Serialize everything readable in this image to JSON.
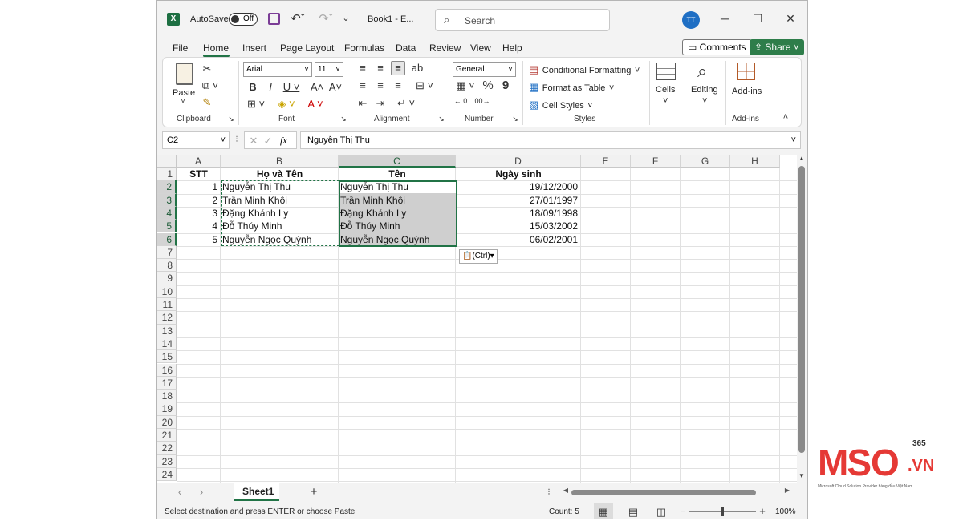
{
  "titlebar": {
    "app_icon": "excel-icon",
    "autosave_label": "AutoSave",
    "autosave_state": "Off",
    "doc_name": "Book1 - E...",
    "search_placeholder": "Search",
    "user_initials": "TT",
    "minimize": "─",
    "maximize": "☐",
    "close": "✕"
  },
  "menu": {
    "items": [
      "File",
      "Home",
      "Insert",
      "Page Layout",
      "Formulas",
      "Data",
      "Review",
      "View",
      "Help"
    ],
    "active": "Home",
    "comments_label": "Comments",
    "share_label": "Share"
  },
  "ribbon": {
    "clipboard": {
      "paste_label": "Paste",
      "group_label": "Clipboard"
    },
    "font": {
      "font_name": "Arial",
      "font_size": "11",
      "group_label": "Font"
    },
    "alignment": {
      "group_label": "Alignment"
    },
    "number": {
      "format": "General",
      "group_label": "Number",
      "percent": "%",
      "comma": "9"
    },
    "styles": {
      "conditional": "Conditional Formatting",
      "format_table": "Format as Table",
      "cell_styles": "Cell Styles",
      "group_label": "Styles"
    },
    "cells_label": "Cells",
    "editing_label": "Editing",
    "addins_label": "Add-ins",
    "addins_group_label": "Add-ins"
  },
  "formula_bar": {
    "name_box": "C2",
    "fx": "fx",
    "content": "Nguyễn Thị Thu"
  },
  "grid": {
    "columns": [
      "A",
      "B",
      "C",
      "D",
      "E",
      "F",
      "G",
      "H"
    ],
    "rows": [
      "1",
      "2",
      "3",
      "4",
      "5",
      "6",
      "7",
      "8",
      "9",
      "10",
      "11",
      "12",
      "13",
      "14",
      "15",
      "16",
      "17",
      "18",
      "19",
      "20",
      "21",
      "22",
      "23",
      "24"
    ],
    "headers": [
      "STT",
      "Họ và Tên",
      "Tên",
      "Ngày sinh"
    ],
    "data": [
      [
        "1",
        "Nguyễn Thị Thu",
        "Nguyễn Thị Thu",
        "19/12/2000"
      ],
      [
        "2",
        "Trần Minh Khôi",
        "Trần Minh Khôi",
        "27/01/1997"
      ],
      [
        "3",
        "Đặng Khánh Ly",
        "Đặng Khánh Ly",
        "18/09/1998"
      ],
      [
        "4",
        "Đỗ Thúy Minh",
        "Đỗ Thúy Minh",
        "15/03/2002"
      ],
      [
        "5",
        "Nguyễn Ngọc Quỳnh",
        "Nguyễn Ngọc Quỳnh",
        "06/02/2001"
      ]
    ],
    "paste_options": "(Ctrl)"
  },
  "sheets": {
    "tabs": [
      "Sheet1"
    ],
    "active": "Sheet1",
    "add": "+"
  },
  "status": {
    "message": "Select destination and press ENTER or choose Paste",
    "count": "Count: 5",
    "zoom": "100%",
    "zoom_level": 0.5
  },
  "logo": {
    "text_a": "MS",
    "text_b": "O",
    "suffix": ".VN",
    "superscript": "365",
    "tagline": "Microsoft Cloud Solution Provider hàng đầu Việt Nam",
    "color": "#e53935"
  }
}
